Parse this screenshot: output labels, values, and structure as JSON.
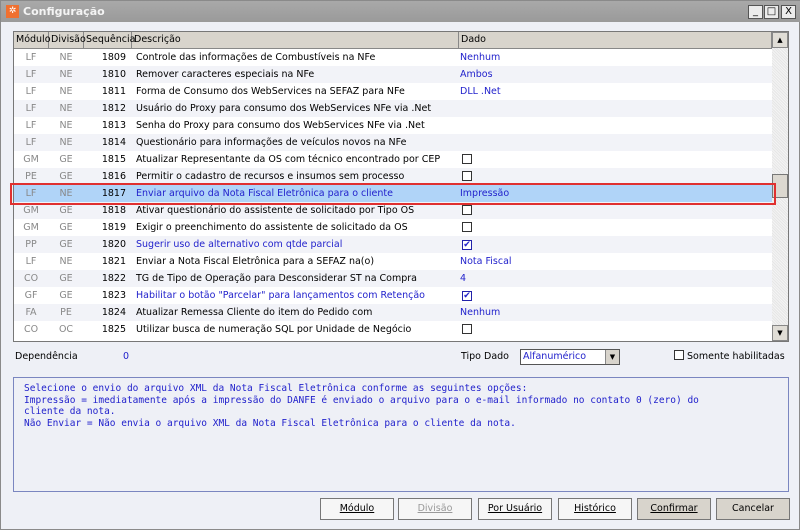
{
  "window": {
    "title": "Configuração",
    "minimize": "_",
    "maximize": "□",
    "close": "X"
  },
  "grid": {
    "headers": {
      "modulo": "Módulo",
      "divisao": "Divisão",
      "sequencia": "Sequência",
      "descricao": "Descrição",
      "dado": "Dado"
    },
    "rows": [
      {
        "modulo": "LF",
        "divisao": "NE",
        "seq": "1809",
        "desc": "Controle das informações de Combustíveis na NFe",
        "dado": "Nenhum",
        "type": "text"
      },
      {
        "modulo": "LF",
        "divisao": "NE",
        "seq": "1810",
        "desc": "Remover caracteres especiais na NFe",
        "dado": "Ambos",
        "type": "text"
      },
      {
        "modulo": "LF",
        "divisao": "NE",
        "seq": "1811",
        "desc": "Forma de Consumo dos WebServices na SEFAZ para NFe",
        "dado": "DLL .Net",
        "type": "text"
      },
      {
        "modulo": "LF",
        "divisao": "NE",
        "seq": "1812",
        "desc": "Usuário do Proxy para consumo dos WebServices NFe via .Net",
        "dado": "",
        "type": "text"
      },
      {
        "modulo": "LF",
        "divisao": "NE",
        "seq": "1813",
        "desc": "Senha do Proxy para consumo dos WebServices NFe via .Net",
        "dado": "",
        "type": "text"
      },
      {
        "modulo": "LF",
        "divisao": "NE",
        "seq": "1814",
        "desc": "Questionário para informações de veículos novos na NFe",
        "dado": "",
        "type": "text"
      },
      {
        "modulo": "GM",
        "divisao": "GE",
        "seq": "1815",
        "desc": "Atualizar Representante da OS com técnico encontrado por CEP",
        "checked": false,
        "type": "checkbox"
      },
      {
        "modulo": "PE",
        "divisao": "GE",
        "seq": "1816",
        "desc": "Permitir o cadastro de recursos e insumos sem processo",
        "checked": false,
        "type": "checkbox"
      },
      {
        "modulo": "LF",
        "divisao": "NE",
        "seq": "1817",
        "desc": "Enviar arquivo da Nota Fiscal Eletrônica para o cliente",
        "dado": "Impressão",
        "type": "text",
        "selected": true,
        "blue": true
      },
      {
        "modulo": "GM",
        "divisao": "GE",
        "seq": "1818",
        "desc": "Ativar questionário do assistente de solicitado por Tipo OS",
        "checked": false,
        "type": "checkbox"
      },
      {
        "modulo": "GM",
        "divisao": "GE",
        "seq": "1819",
        "desc": "Exigir o preenchimento do assistente de solicitado da OS",
        "checked": false,
        "type": "checkbox"
      },
      {
        "modulo": "PP",
        "divisao": "GE",
        "seq": "1820",
        "desc": "Sugerir uso de alternativo com qtde parcial",
        "checked": true,
        "type": "checkbox",
        "blue": true
      },
      {
        "modulo": "LF",
        "divisao": "NE",
        "seq": "1821",
        "desc": "Enviar a Nota Fiscal Eletrônica para a SEFAZ na(o)",
        "dado": "Nota Fiscal",
        "type": "text"
      },
      {
        "modulo": "CO",
        "divisao": "GE",
        "seq": "1822",
        "desc": "TG de Tipo de Operação para Desconsiderar ST na Compra",
        "dado": "4",
        "type": "text"
      },
      {
        "modulo": "GF",
        "divisao": "GE",
        "seq": "1823",
        "desc": "Habilitar o botão \"Parcelar\" para lançamentos com Retenção",
        "checked": true,
        "type": "checkbox",
        "blue": true
      },
      {
        "modulo": "FA",
        "divisao": "PE",
        "seq": "1824",
        "desc": "Atualizar Remessa Cliente do item do Pedido com",
        "dado": "Nenhum",
        "type": "text"
      },
      {
        "modulo": "CO",
        "divisao": "OC",
        "seq": "1825",
        "desc": "Utilizar busca de numeração SQL por Unidade de Negócio",
        "checked": false,
        "type": "checkbox"
      }
    ]
  },
  "filters": {
    "dependencia_label": "Dependência",
    "dependencia_value": "0",
    "tipo_dado_label": "Tipo Dado",
    "tipo_dado_value": "Alfanumérico",
    "somente_label": "Somente habilitadas",
    "somente_checked": false
  },
  "info": "Selecione o envio do arquivo XML da Nota Fiscal Eletrônica conforme as seguintes opções:\nImpressão = imediatamente após a impressão do DANFE é enviado o arquivo para o e-mail informado no contato 0 (zero) do\ncliente da nota.\nNão Enviar = Não envia o arquivo XML da Nota Fiscal Eletrônica para o cliente da nota.",
  "buttons": {
    "modulo": "Módulo",
    "divisao": "Divisão",
    "por_usuario": "Por Usuário",
    "historico": "Histórico",
    "confirmar": "Confirmar",
    "cancelar": "Cancelar"
  }
}
